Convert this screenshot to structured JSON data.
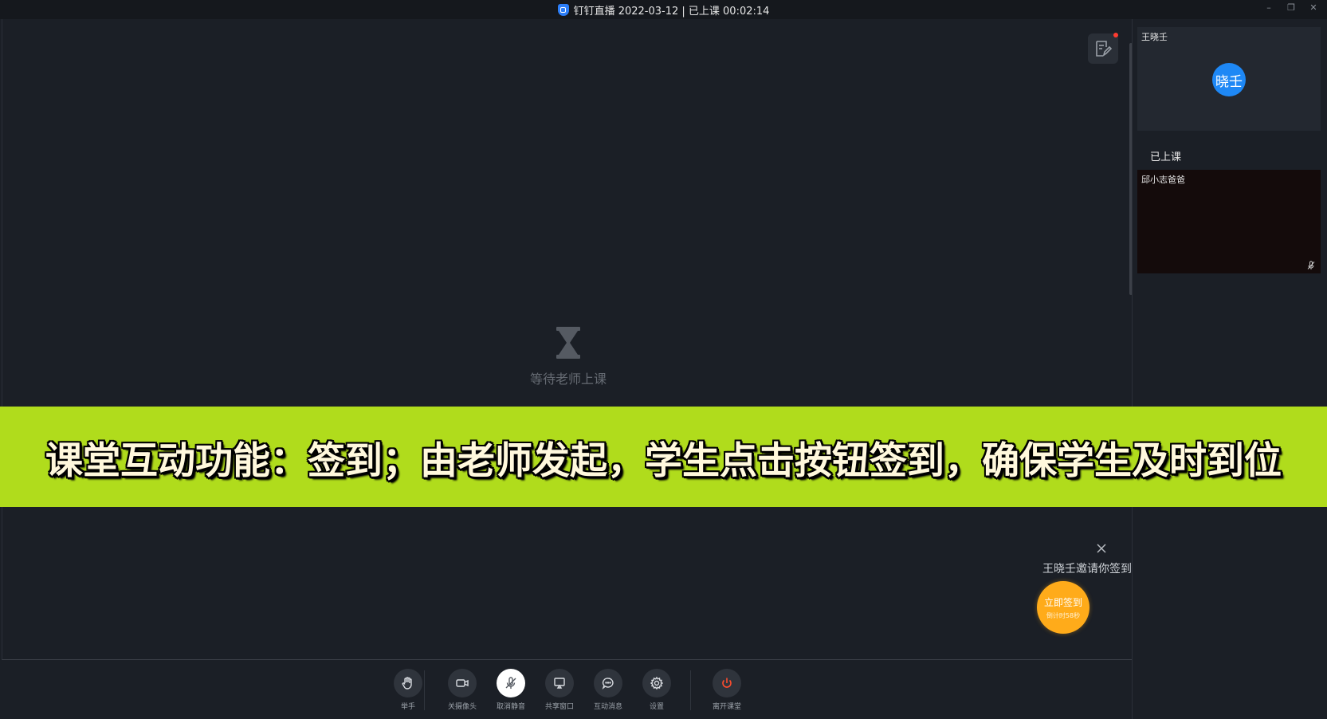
{
  "titlebar": {
    "title": "钉钉直播 2022-03-12 | 已上课 00:02:14",
    "controls": [
      "–",
      "❐",
      "✕"
    ]
  },
  "stage": {
    "waiting_text": "等待老师上课",
    "note_icon": "edit-note-icon"
  },
  "banner": {
    "text": "课堂互动功能：签到；由老师发起，学生点击按钮签到，确保学生及时到位"
  },
  "signin": {
    "invite_text": "王晓壬邀请你签到",
    "button_label": "立即签到",
    "countdown": "倒计时58秒"
  },
  "toolbar": {
    "raise_hand": "举手",
    "camera_off": "关摄像头",
    "unmute": "取消静音",
    "share_window": "共享窗口",
    "messages": "互动消息",
    "settings": "设置",
    "leave": "离开课堂"
  },
  "right_panel": {
    "teacher_name": "王晓壬",
    "teacher_avatar": "晓壬",
    "section_label": "已上课",
    "student_name": "邱小志爸爸"
  },
  "colors": {
    "accent_blue": "#1e88f5",
    "signin_orange": "#ffab1a",
    "leave_red": "#ff4d2e",
    "banner_green": "#b0dc1c"
  }
}
